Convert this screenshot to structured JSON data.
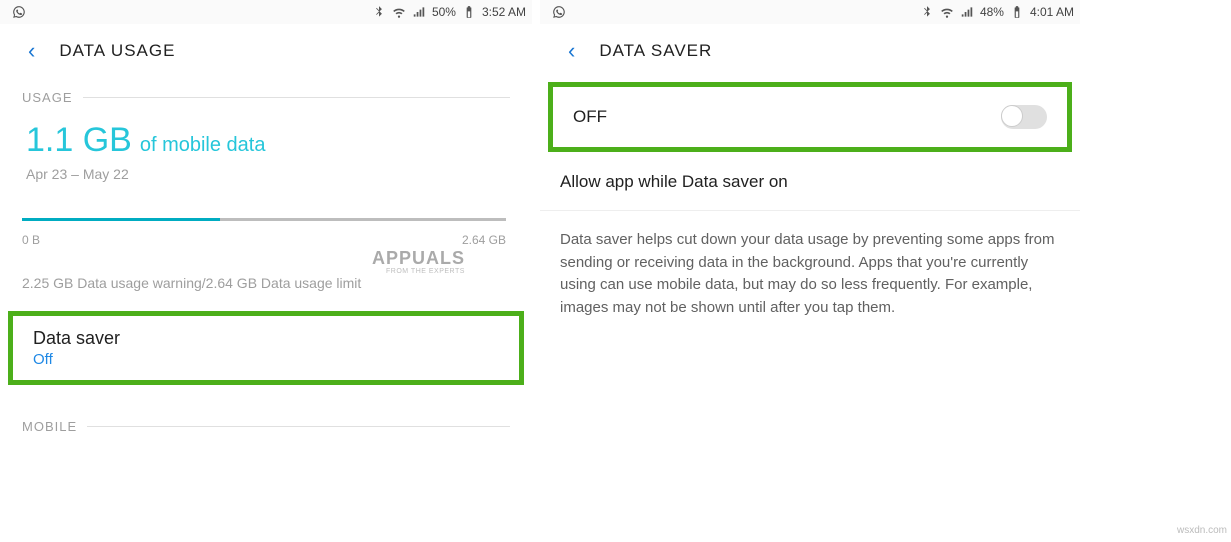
{
  "left": {
    "statusbar": {
      "battery_pct": "50%",
      "time": "3:52 AM"
    },
    "nav": {
      "title": "DATA USAGE"
    },
    "section_usage": "USAGE",
    "usage_big": "1.1 GB",
    "usage_rest": "of mobile data",
    "period": "Apr 23 – May 22",
    "bar_min": "0 B",
    "bar_max": "2.64 GB",
    "warning": "2.25 GB Data usage warning/2.64 GB Data usage limit",
    "data_saver_title": "Data saver",
    "data_saver_status": "Off",
    "section_mobile": "MOBILE"
  },
  "right": {
    "statusbar": {
      "battery_pct": "48%",
      "time": "4:01 AM"
    },
    "nav": {
      "title": "DATA SAVER"
    },
    "toggle_label": "OFF",
    "allow_label": "Allow app while Data saver on",
    "description": "Data saver helps cut down your data usage by preventing some apps from sending or receiving data in the background. Apps that you're currently using can use mobile data, but may do so less frequently. For example, images may not be shown until after you tap them."
  },
  "watermark": "wsxdn.com",
  "appuals": "APPUALS",
  "appuals_sub": "FROM THE EXPERTS"
}
